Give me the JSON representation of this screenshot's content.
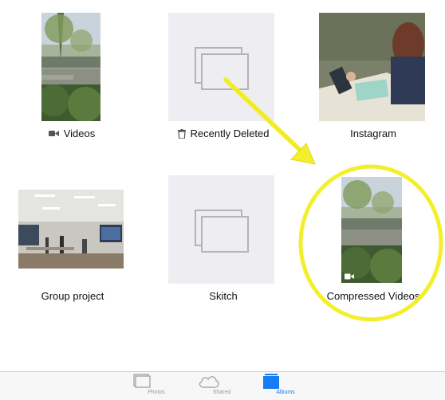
{
  "colors": {
    "highlight": "#f4ef2c",
    "accent": "#1a7cf5",
    "placeholder_bg": "#eeeef2",
    "tab_inactive": "#9a9a9e"
  },
  "albums": [
    {
      "label": "Videos",
      "icon": "video-camera-icon"
    },
    {
      "label": "Recently Deleted",
      "icon": "trash-icon"
    },
    {
      "label": "Instagram"
    },
    {
      "label": "Group project"
    },
    {
      "label": "Skitch"
    },
    {
      "label": "Compressed Videos",
      "badge_icon": "video-camera-icon"
    }
  ],
  "tabs": [
    {
      "label": "Photos",
      "icon": "photos-icon",
      "active": false
    },
    {
      "label": "Shared",
      "icon": "cloud-icon",
      "active": false
    },
    {
      "label": "Albums",
      "icon": "albums-icon",
      "active": true
    }
  ]
}
